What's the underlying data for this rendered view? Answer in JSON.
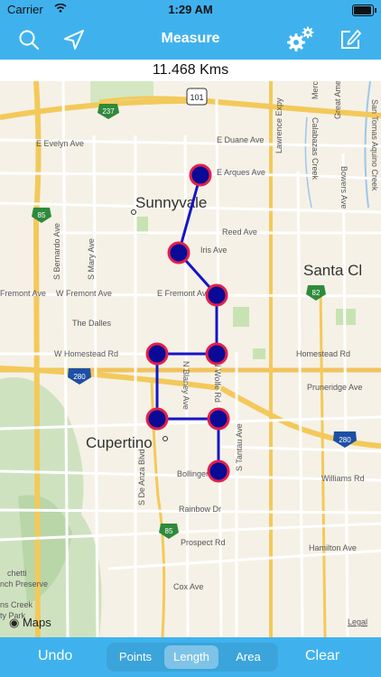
{
  "status": {
    "carrier": "Carrier",
    "time": "1:29 AM"
  },
  "navbar": {
    "title": "Measure"
  },
  "distance": "11.468 Kms",
  "map": {
    "cities": [
      "Sunnyvale",
      "Santa Cl",
      "Cupertino"
    ],
    "streets": [
      "E Duane Ave",
      "E Evelyn Ave",
      "E Arques Ave",
      "Reed Ave",
      "Iris Ave",
      "E Fremont Ave",
      "W Fremont Ave",
      "Fremont Ave",
      "The Dalles",
      "W Homestead Rd",
      "Homestead Rd",
      "Pruneridge Ave",
      "Williams Rd",
      "Bollinger Rd",
      "Rainbow Dr",
      "Prospect Rd",
      "Cox Ave",
      "Hamilton Ave",
      "Lawrence Expy",
      "S Bernardo Ave",
      "S Mary Ave",
      "N Blaney Ave",
      "N Wolfe Rd",
      "S De Anza Blvd",
      "S Tantau Ave",
      "Bowers Ave",
      "Calabazas Creek",
      "San Tomas Aquino Creek",
      "Great America",
      "Mercy Ave"
    ],
    "highways": [
      "101",
      "237",
      "85",
      "82",
      "280",
      "280",
      "85"
    ],
    "parks": [
      "chetti",
      "nch Preserve",
      "ns Creek",
      "ty Park"
    ],
    "attribution": "Maps",
    "legal": "Legal"
  },
  "toolbar": {
    "undo": "Undo",
    "clear": "Clear",
    "modes": [
      "Points",
      "Length",
      "Area"
    ],
    "selected_mode": "Length"
  },
  "colors": {
    "bar": "#3fb2ee",
    "route": "#1515c8",
    "point_fill": "#0a0a96",
    "point_ring": "#e2204a"
  }
}
